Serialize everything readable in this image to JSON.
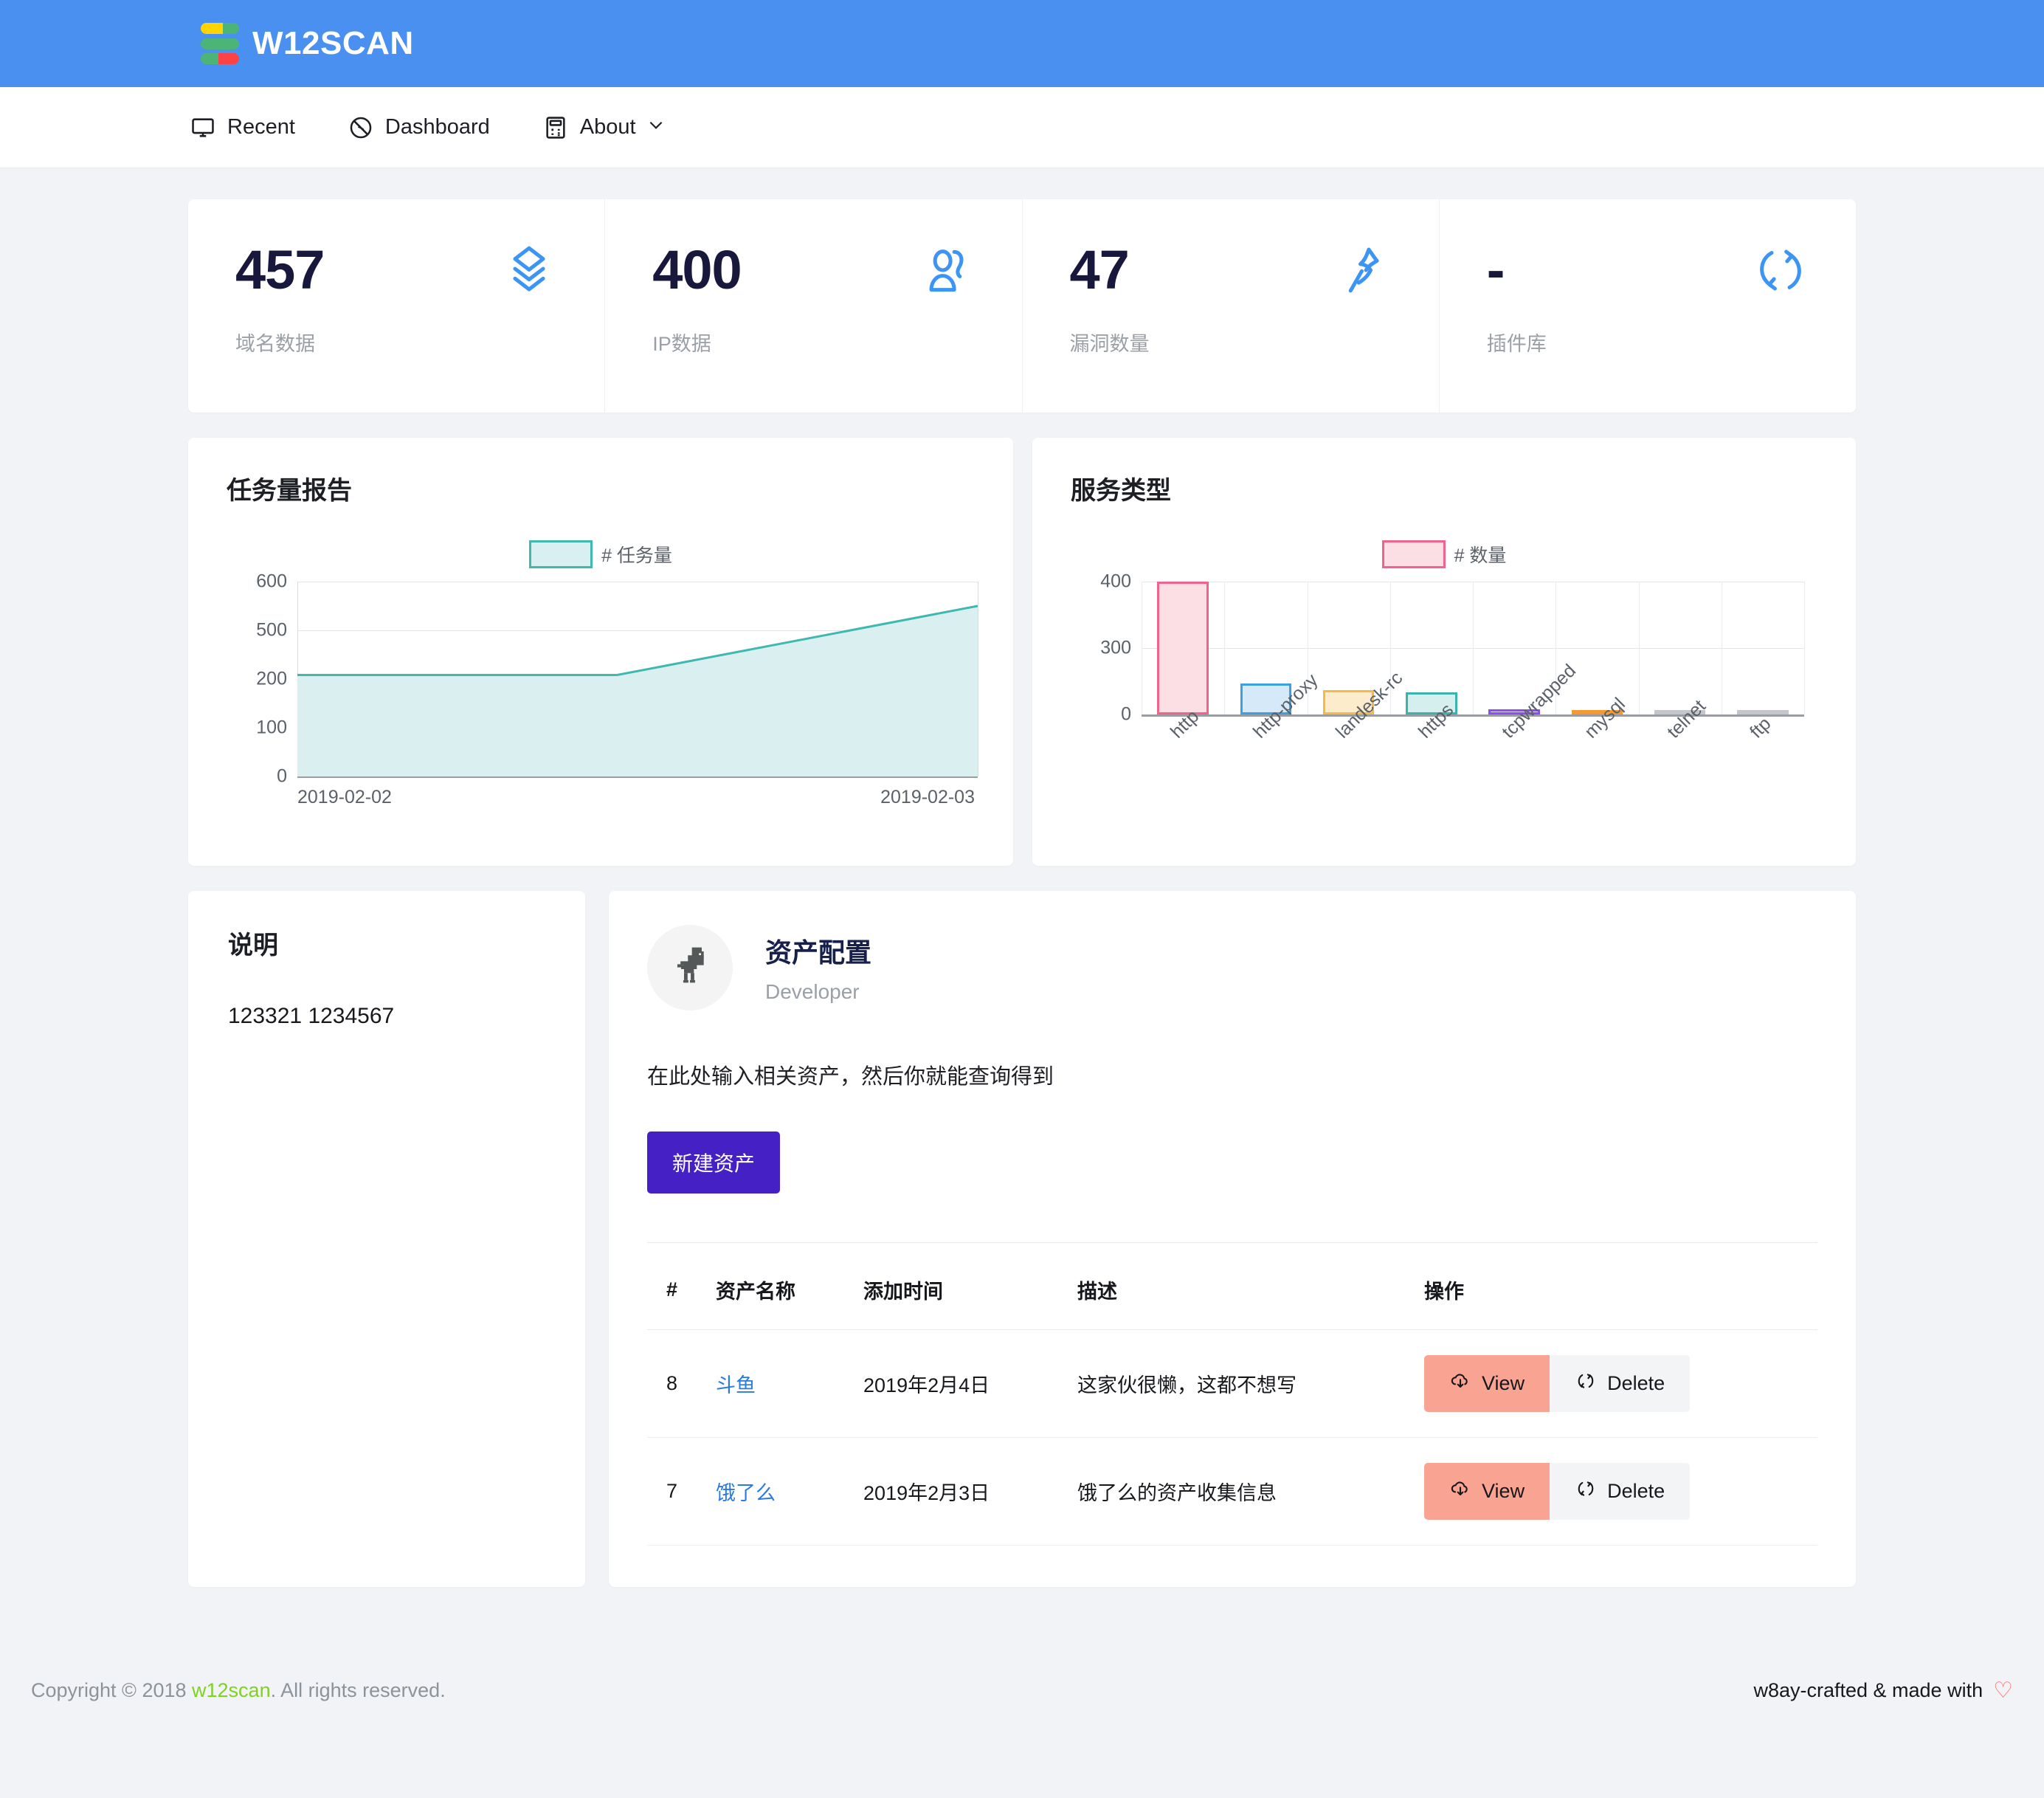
{
  "header": {
    "brand": "W12SCAN",
    "logo_colors": {
      "yellow": "#ffd400",
      "green": "#4cb477",
      "red": "#fc4245"
    },
    "bar_color": "#4a90f0"
  },
  "nav": {
    "items": [
      {
        "label": "Recent",
        "icon": "monitor-icon"
      },
      {
        "label": "Dashboard",
        "icon": "ban-circle-icon"
      },
      {
        "label": "About",
        "icon": "calculator-icon",
        "caret": "chevron-down-icon"
      }
    ]
  },
  "stats": [
    {
      "value": "457",
      "label": "域名数据",
      "icon": "layers-icon"
    },
    {
      "value": "400",
      "label": "IP数据",
      "icon": "user-icon"
    },
    {
      "value": "47",
      "label": "漏洞数量",
      "icon": "pin-icon"
    },
    {
      "value": "-",
      "label": "插件库",
      "icon": "refresh-icon"
    }
  ],
  "chart_data": [
    {
      "type": "area",
      "title": "任务量报告",
      "legend": "# 任务量",
      "legend_position": "top-center",
      "x": [
        "2019-02-02",
        "2019-02-03"
      ],
      "categories": [
        "2019-02-02",
        "2019-02-03"
      ],
      "series": [
        {
          "name": "# 任务量",
          "values": [
            225,
            225,
            550
          ]
        }
      ],
      "values": [
        225,
        225,
        550
      ],
      "xlabel": "",
      "ylabel": "",
      "ylim": [
        0,
        600
      ],
      "yticks": [
        600,
        500,
        200,
        100,
        0
      ],
      "grid": true,
      "line_color": "#3fb8b0",
      "fill_color": "#d9eff0"
    },
    {
      "type": "bar",
      "title": "服务类型",
      "legend": "# 数量",
      "legend_position": "top-center",
      "categories": [
        "http",
        "http-proxy",
        "landesk-rc",
        "https",
        "tcpwrapped",
        "mysql",
        "telnet",
        "ftp"
      ],
      "values": [
        400,
        140,
        110,
        100,
        22,
        10,
        6,
        3
      ],
      "xlabel": "",
      "ylabel": "",
      "ylim": [
        0,
        400
      ],
      "yticks": [
        400,
        300,
        0
      ],
      "grid": true,
      "bar_colors": [
        {
          "fill": "#fcdee5",
          "stroke": "#f2628c"
        },
        {
          "fill": "#d6e9f8",
          "stroke": "#3fa0e0"
        },
        {
          "fill": "#fdeccb",
          "stroke": "#f3ba44"
        },
        {
          "fill": "#d4efee",
          "stroke": "#39b3ac"
        },
        {
          "fill": "#e6ddfb",
          "stroke": "#8b4bf5"
        },
        {
          "fill": "#fde9d0",
          "stroke": "#f59a31"
        },
        {
          "fill": "#e4e6e8",
          "stroke": "#c3c6ca"
        },
        {
          "fill": "#e4e6e8",
          "stroke": "#c3c6ca"
        }
      ]
    }
  ],
  "note": {
    "title": "说明",
    "body": "123321 1234567"
  },
  "asset": {
    "avatar_icon": "dinosaur-icon",
    "name": "资产配置",
    "role": "Developer",
    "hint": "在此处输入相关资产，然后你就能查询得到",
    "new_button": "新建资产",
    "table": {
      "columns": [
        "#",
        "资产名称",
        "添加时间",
        "描述",
        "操作"
      ],
      "rows": [
        {
          "index": "8",
          "name": "斗鱼",
          "time": "2019年2月4日",
          "desc": "这家伙很懒，这都不想写",
          "view": "View",
          "delete": "Delete"
        },
        {
          "index": "7",
          "name": "饿了么",
          "time": "2019年2月3日",
          "desc": "饿了么的资产收集信息",
          "view": "View",
          "delete": "Delete"
        }
      ]
    }
  },
  "footer": {
    "copyright_pre": "Copyright © 2018 ",
    "link": "w12scan",
    "copyright_post": ". All rights reserved.",
    "right": "w8ay-crafted & made with",
    "heart": "♡"
  }
}
